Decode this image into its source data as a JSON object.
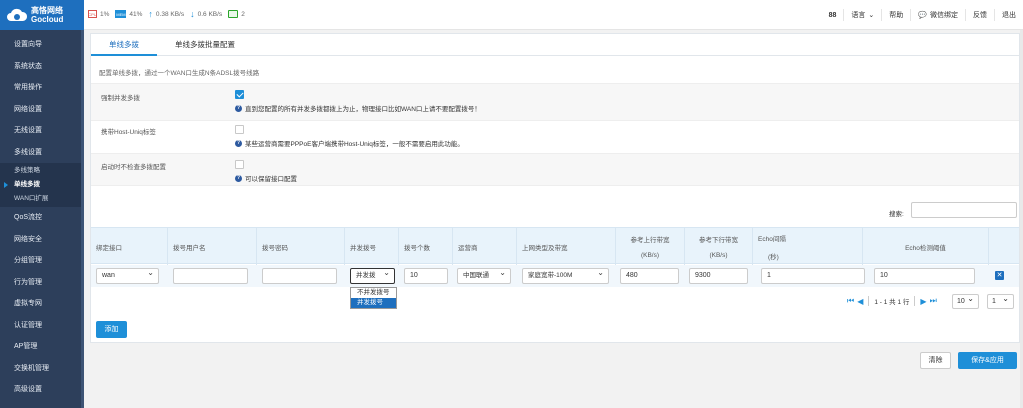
{
  "brand": {
    "name_cn": "高恪网络",
    "name_en": "Gocloud"
  },
  "status": {
    "cpu_icon": "cpu-icon",
    "cpu": "1%",
    "mem_icon": "memory-icon",
    "mem": "41%",
    "upload": "0.38 KB/s",
    "download": "0.6 KB/s",
    "terminals": "2"
  },
  "topright": {
    "count": "88",
    "language": "语言",
    "help": "帮助",
    "wechat": "微信绑定",
    "feedback": "反馈",
    "logout": "退出"
  },
  "sidebar": {
    "items": [
      "设置向导",
      "系统状态",
      "常用操作",
      "网络设置",
      "无线设置",
      "多线设置"
    ],
    "sub_items": [
      "多线策略",
      "单线多拨",
      "WAN口扩展"
    ],
    "items_after": [
      "QoS流控",
      "网络安全",
      "分组管理",
      "行为管理",
      "虚拟专网",
      "认证管理",
      "AP管理",
      "交换机管理",
      "高级设置"
    ]
  },
  "tabs": [
    "单线多拨",
    "单线多拨批量配置"
  ],
  "description": "配置单线多拨，通过一个WAN口生成N条ADSL拨号线路",
  "options": {
    "force_concurrent": {
      "label": "强制并发多拨",
      "checked": true,
      "hint": "直到您配置的所有并发多拨都拨上为止，物理接口比如WAN口上请不要配置拨号！"
    },
    "host_uniq": {
      "label": "携带Host-Uniq标签",
      "checked": false,
      "hint": "某些运营商需要PPPoE客户端携带Host-Uniq标签，一般不需要启用此功能。"
    },
    "no_check": {
      "label": "启动时不检查多拨配置",
      "checked": false,
      "hint": "可以保留接口配置"
    }
  },
  "search_label": "搜索:",
  "table": {
    "headers": {
      "iface": "绑定接口",
      "user": "拨号用户名",
      "pass": "拨号密码",
      "mode": "并发拨号",
      "count": "拨号个数",
      "isp": "运营商",
      "uplink_type": "上网类型及带宽",
      "up_bw_1": "参考上行带宽",
      "up_bw_2": "(KB/s)",
      "down_bw_1": "参考下行带宽",
      "down_bw_2": "(KB/s)",
      "echo_int_1": "Echo间隔",
      "echo_int_2": "(秒)",
      "echo_th": "Echo检测阈值"
    },
    "row": {
      "iface": "wan",
      "user": "",
      "pass": "",
      "mode": "并发拨",
      "count": "10",
      "isp": "中国联通",
      "uplink_type": "家庭宽带-100M",
      "up_bw": "480",
      "down_bw": "9300",
      "echo_int": "1",
      "echo_th": "10"
    },
    "mode_options": [
      "不并发拨号",
      "并发拨号"
    ],
    "mode_selected_index": 1
  },
  "pager": {
    "info": "1 - 1 共 1 行",
    "page_size": "10",
    "page": "1"
  },
  "buttons": {
    "add": "添加",
    "clear": "清除",
    "save": "保存&应用"
  },
  "colors": {
    "accent": "#1e8fd8",
    "sidebar": "#2d3f5b",
    "header_row": "#e8f3fb"
  }
}
